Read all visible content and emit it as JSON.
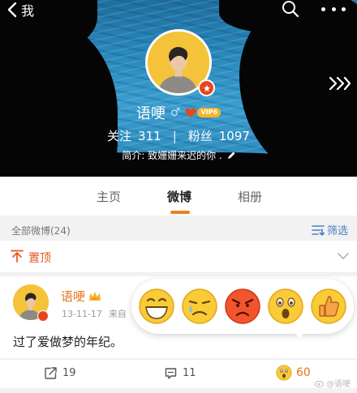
{
  "header": {
    "back_label": "我",
    "back_icon": "chevron-left-icon",
    "search_icon": "search-icon",
    "more_icon": "more-dots-icon",
    "expand_icon": "double-chevron-right-icon"
  },
  "profile": {
    "name": "语哽",
    "gender_symbol": "♂",
    "vip_label": "VIP6",
    "following_label": "关注",
    "following_count": "311",
    "followers_label": "粉丝",
    "followers_count": "1097",
    "bio": "简介: 致姗姗来迟的你 .",
    "edit_icon": "pencil-icon"
  },
  "tabs": [
    {
      "label": "主页",
      "active": false
    },
    {
      "label": "微博",
      "active": true
    },
    {
      "label": "相册",
      "active": false
    }
  ],
  "filter": {
    "count_label": "全部微博(24)",
    "filter_label": "筛选",
    "filter_icon": "filter-icon"
  },
  "pinned": {
    "label": "置顶",
    "icon": "pin-icon",
    "collapse_icon": "chevron-down-icon"
  },
  "post": {
    "username": "语哽",
    "date": "13-11-17",
    "source": "来自",
    "text": "过了爱做梦的年纪。",
    "repost_count": "19",
    "comment_count": "11",
    "like_count": "60"
  },
  "reactions": [
    "grin-icon",
    "tears-icon",
    "angry-icon",
    "surprised-icon",
    "thumbs-up-icon"
  ],
  "watermark": "@语哽",
  "colors": {
    "accent_orange": "#f07e1f",
    "link_blue": "#4a7fc1",
    "pin_red": "#e8531c",
    "avatar_yellow": "#f4c33a"
  }
}
